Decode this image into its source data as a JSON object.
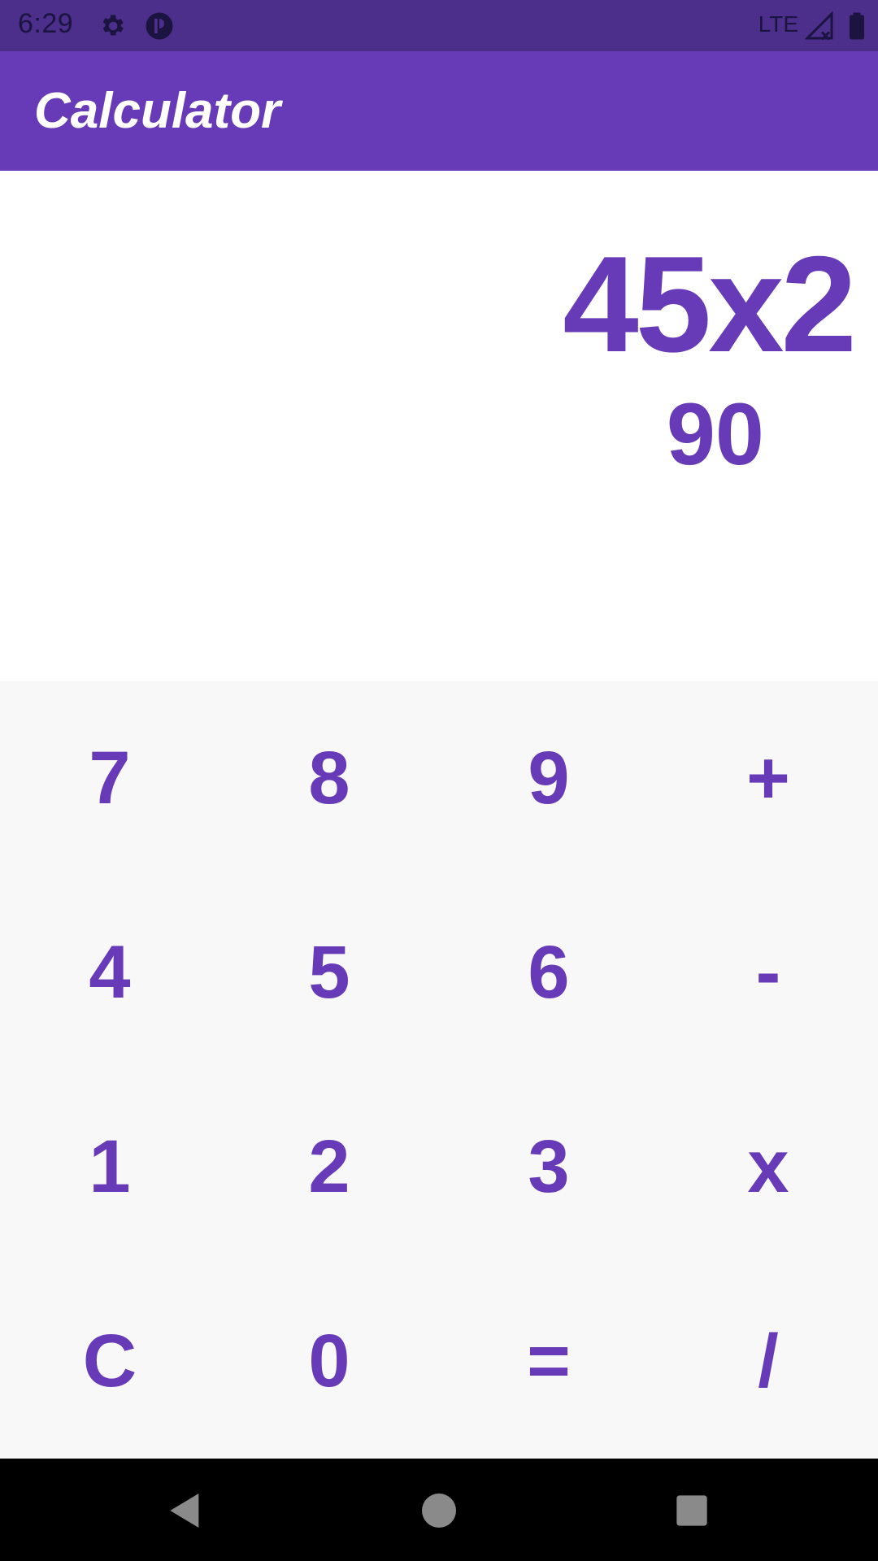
{
  "status_bar": {
    "time": "6:29",
    "network": "LTE",
    "icons": [
      "settings-gear-icon",
      "data-saver-icon",
      "signal-icon",
      "battery-icon"
    ]
  },
  "app": {
    "title": "Calculator",
    "accent_color": "#673ab7"
  },
  "display": {
    "expression": "45x2",
    "result": "90"
  },
  "keypad": {
    "keys": [
      "7",
      "8",
      "9",
      "+",
      "4",
      "5",
      "6",
      "-",
      "1",
      "2",
      "3",
      "x",
      "C",
      "0",
      "=",
      "/"
    ]
  },
  "nav_bar": {
    "icons": [
      "back-icon",
      "home-icon",
      "recents-icon"
    ]
  }
}
